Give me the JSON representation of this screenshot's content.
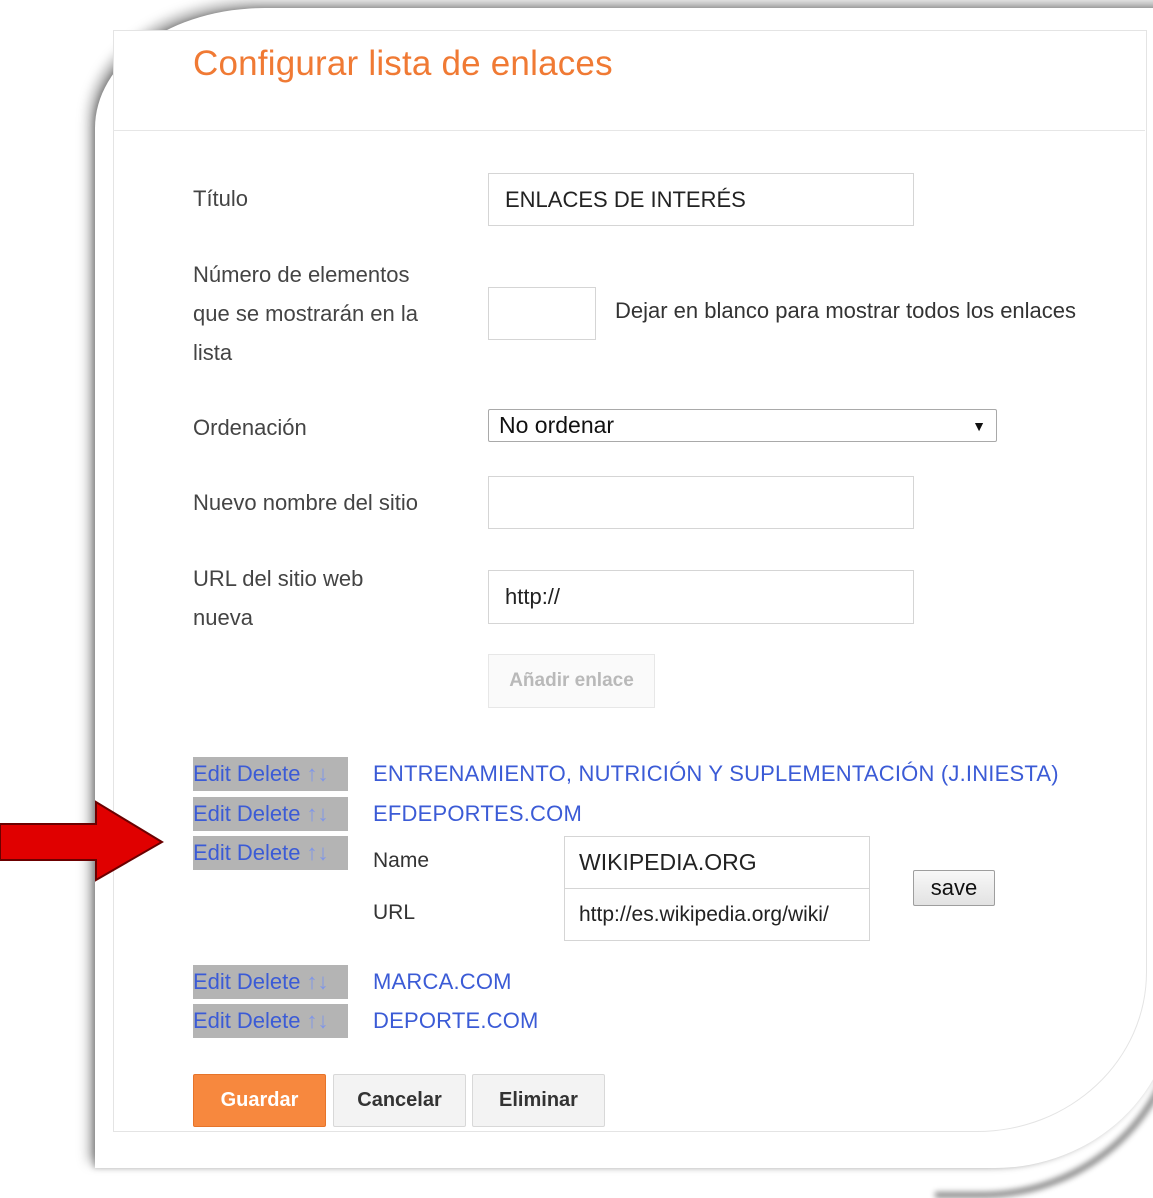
{
  "header": {
    "title": "Configurar lista de enlaces"
  },
  "form": {
    "title_label": "Título",
    "title_value": "ENLACES DE INTERÉS",
    "count_label_line1": "Número de elementos",
    "count_label_line2": "que se mostrarán en la",
    "count_label_line3": "lista",
    "count_value": "",
    "count_hint": "Dejar en blanco para mostrar todos los enlaces",
    "order_label": "Ordenación",
    "order_selected": "No ordenar",
    "new_name_label": "Nuevo nombre del sitio",
    "new_name_value": "",
    "new_url_label_line1": "URL del sitio web",
    "new_url_label_line2": "nueva",
    "new_url_value": "http://",
    "add_link_label": "Añadir enlace"
  },
  "links": {
    "edit_label": "Edit",
    "delete_label": "Delete",
    "move_arrows": "↑↓",
    "items": [
      {
        "name": "ENTRENAMIENTO, NUTRICIÓN Y SUPLEMENTACIÓN (J.INIESTA)"
      },
      {
        "name": "EFDEPORTES.COM"
      },
      {
        "name": "WIKIPEDIA.ORG",
        "url": "http://es.wikipedia.org/wiki/"
      },
      {
        "name": "MARCA.COM"
      },
      {
        "name": "DEPORTE.COM"
      }
    ],
    "editor": {
      "name_label": "Name",
      "url_label": "URL",
      "save_label": "save"
    }
  },
  "footer": {
    "save_label": "Guardar",
    "cancel_label": "Cancelar",
    "delete_label": "Eliminar"
  },
  "colors": {
    "title": "#f07a34",
    "link": "#3b5bd6",
    "primary_button": "#f7883e",
    "action_bg": "#b4b4b4",
    "arrow": "#e00000"
  }
}
